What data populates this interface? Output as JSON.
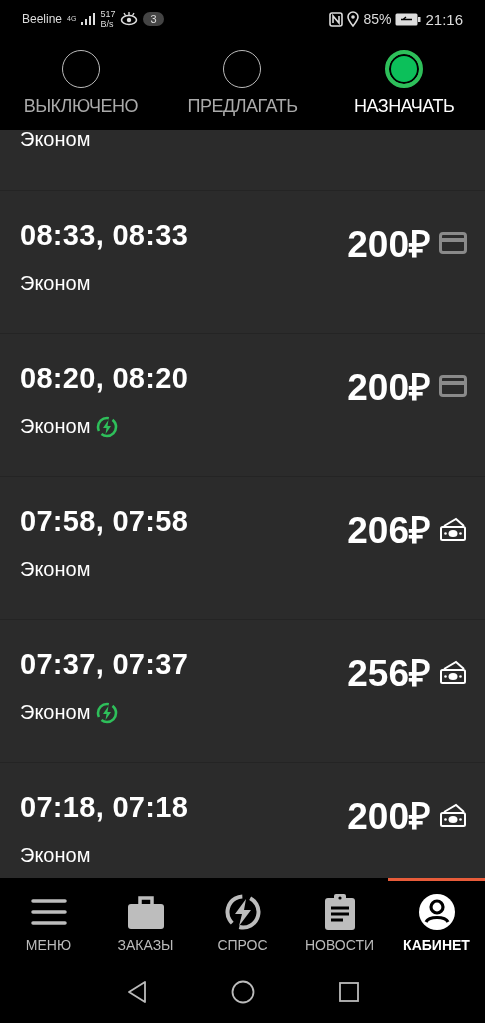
{
  "status_bar": {
    "carrier": "Beeline",
    "network": "4G",
    "speed_value": "517",
    "speed_unit": "B/s",
    "notification_count": "3",
    "battery": "85%",
    "time": "21:16"
  },
  "modes": [
    {
      "label": "ВЫКЛЮЧЕНО",
      "selected": false
    },
    {
      "label": "ПРЕДЛАГАТЬ",
      "selected": false
    },
    {
      "label": "НАЗНАЧАТЬ",
      "selected": true
    }
  ],
  "orders": [
    {
      "kind": "partial",
      "tariff": "Эконом",
      "surge": false
    },
    {
      "kind": "full",
      "times": "08:33, 08:33",
      "price": "200₽",
      "payment": {
        "kind": "card"
      },
      "tariff": "Эконом",
      "surge": false
    },
    {
      "kind": "full",
      "times": "08:20, 08:20",
      "price": "200₽",
      "payment": {
        "kind": "card"
      },
      "tariff": "Эконом",
      "surge": true
    },
    {
      "kind": "full",
      "times": "07:58, 07:58",
      "price": "206₽",
      "payment": {
        "kind": "cash"
      },
      "tariff": "Эконом",
      "surge": false
    },
    {
      "kind": "full",
      "times": "07:37, 07:37",
      "price": "256₽",
      "payment": {
        "kind": "cash"
      },
      "tariff": "Эконом",
      "surge": true
    },
    {
      "kind": "full",
      "times": "07:18, 07:18",
      "price": "200₽",
      "payment": {
        "kind": "cash"
      },
      "tariff": "Эконом",
      "surge": false
    }
  ],
  "bottom_nav": [
    {
      "label": "МЕНЮ",
      "selected": false
    },
    {
      "label": "ЗАКАЗЫ",
      "selected": false
    },
    {
      "label": "СПРОС",
      "selected": false
    },
    {
      "label": "НОВОСТИ",
      "selected": false
    },
    {
      "label": "КАБИНЕТ",
      "selected": true
    }
  ]
}
